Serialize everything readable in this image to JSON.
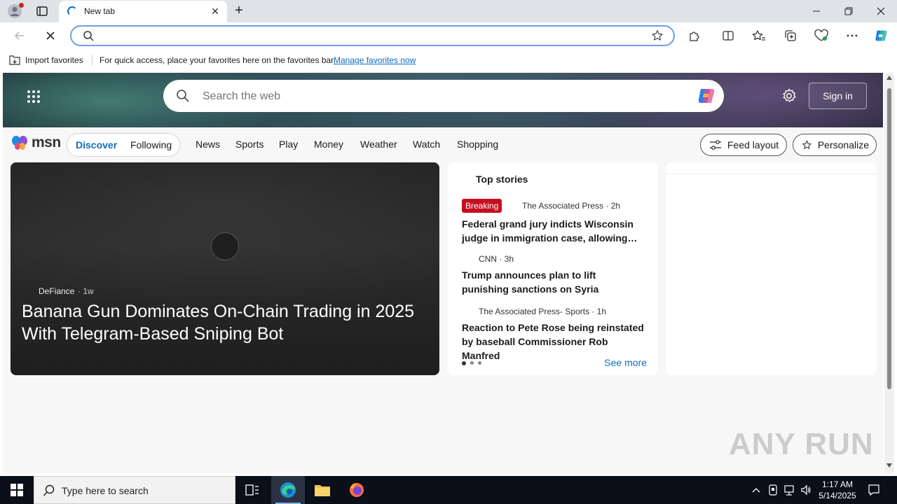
{
  "browser": {
    "tab_title": "New tab",
    "address_value": "",
    "favorites_bar": {
      "import_label": "Import favorites",
      "message": "For quick access, place your favorites here on the favorites bar.",
      "link": "Manage favorites now"
    }
  },
  "msn": {
    "search_placeholder": "Search the web",
    "sign_in": "Sign in",
    "logo_text": "msn",
    "pills": {
      "discover": "Discover",
      "following": "Following"
    },
    "nav": [
      "News",
      "Sports",
      "Play",
      "Money",
      "Weather",
      "Watch",
      "Shopping"
    ],
    "feed_layout": "Feed layout",
    "personalize": "Personalize",
    "hero": {
      "source": "DeFiance",
      "age": "1w",
      "headline": "Banana Gun Dominates On-Chain Trading in 2025 With Telegram-Based Sniping Bot"
    },
    "top_stories": {
      "title": "Top stories",
      "stories": [
        {
          "badge": "Breaking",
          "meta": "The Associated Press · 2h",
          "headline": "Federal grand jury indicts Wisconsin judge in immigration case, allowing…"
        },
        {
          "meta": "CNN · 3h",
          "headline": "Trump announces plan to lift punishing sanctions on Syria"
        },
        {
          "meta": "The Associated Press- Sports · 1h",
          "headline": "Reaction to Pete Rose being reinstated by baseball Commissioner Rob Manfred"
        }
      ],
      "see_more": "See more"
    }
  },
  "watermark": "ANY RUN",
  "taskbar": {
    "search_placeholder": "Type here to search",
    "time": "1:17 AM",
    "date": "5/14/2025"
  },
  "colors": {
    "accent": "#0f6cbd",
    "breaking": "#c50f1f",
    "taskbar": "#0b0f1a"
  }
}
